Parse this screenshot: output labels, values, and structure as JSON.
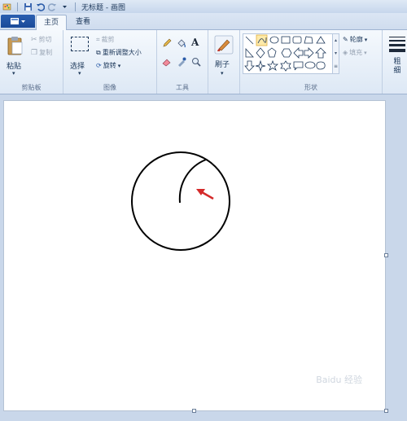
{
  "window": {
    "title": "无标题 - 画图"
  },
  "tabs": [
    {
      "label": "主页"
    },
    {
      "label": "查看"
    }
  ],
  "clipboard": {
    "paste": "粘贴",
    "cut": "剪切",
    "copy": "复制",
    "group_label": "剪贴板"
  },
  "image": {
    "select": "选择",
    "crop": "裁剪",
    "resize": "重新调整大小",
    "rotate": "旋转",
    "group_label": "图像"
  },
  "tools": {
    "group_label": "工具"
  },
  "brushes": {
    "label": "刷子"
  },
  "shapes": {
    "outline": "轮廓",
    "fill": "填充",
    "group_label": "形状"
  },
  "size": {
    "label": "粗细"
  },
  "watermark": {
    "text": "Baidu 经验"
  },
  "colors": {
    "accent": "#1a4a99",
    "arrow": "#d42a2a"
  }
}
